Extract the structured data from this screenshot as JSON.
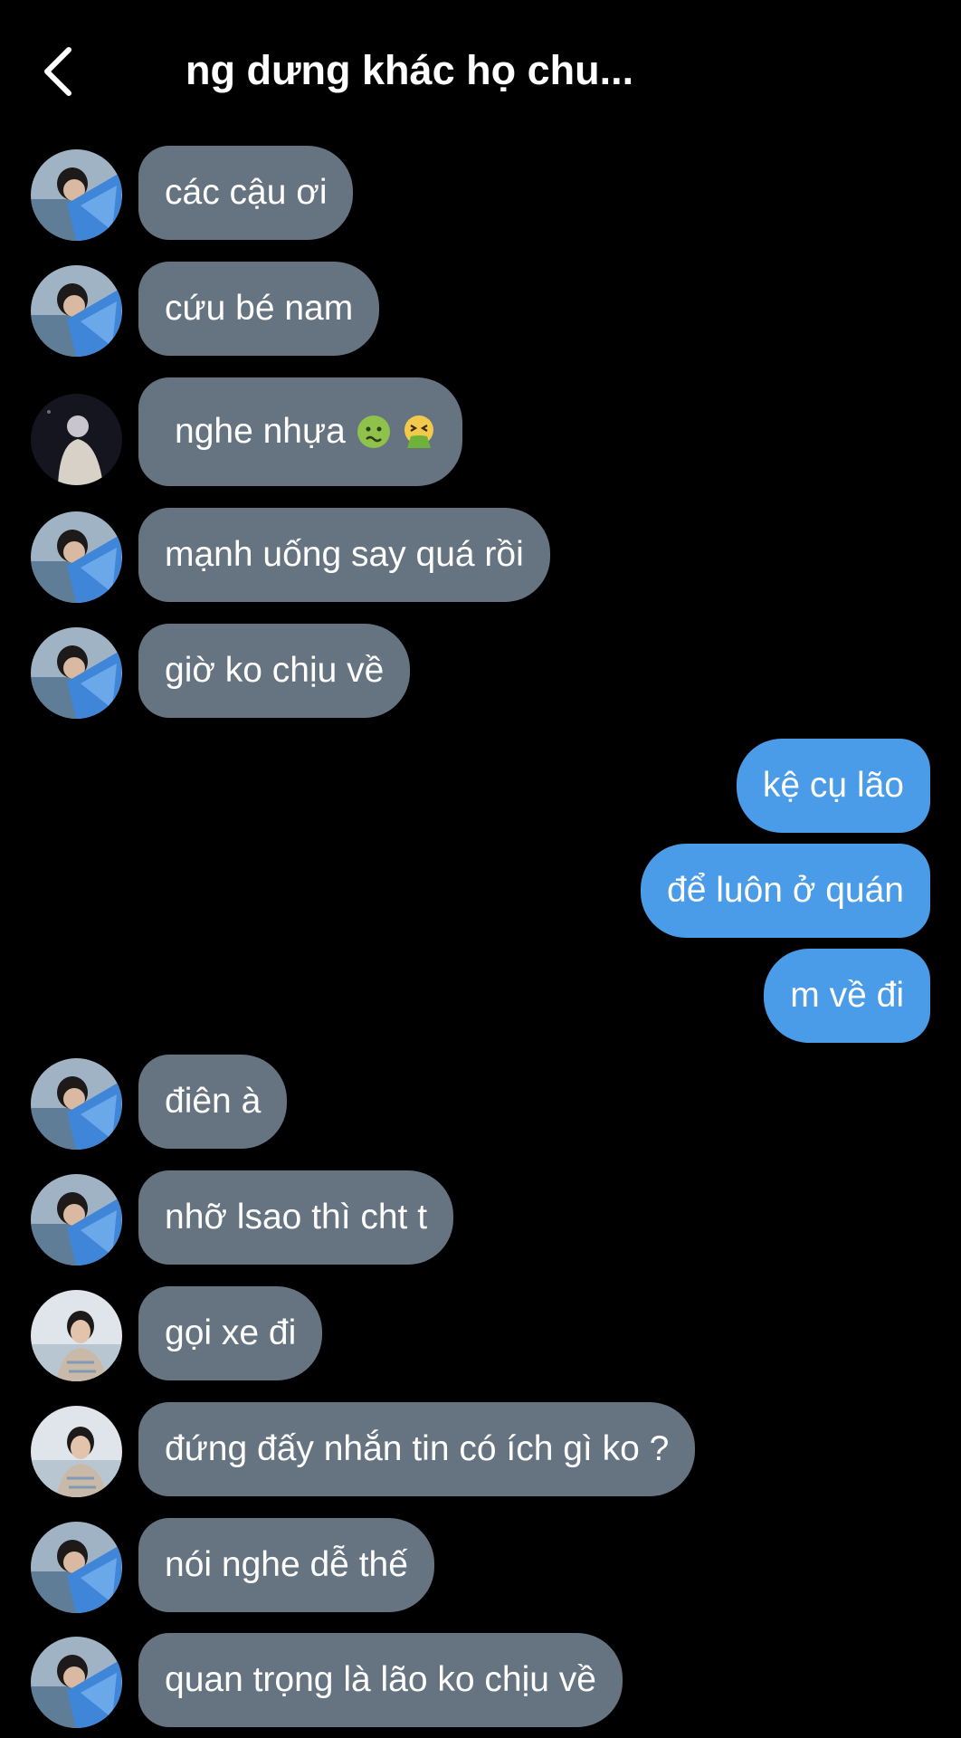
{
  "header": {
    "title": "ng dưng khác họ chu...",
    "back_icon": "chevron-left-icon"
  },
  "colors": {
    "background": "#000000",
    "incoming_bubble": "#667380",
    "outgoing_bubble": "#4a9be8",
    "text": "#ffffff"
  },
  "messages": [
    {
      "direction": "in",
      "sender_avatar": "avatar-boy-blue-shirt",
      "text": "các cậu ơi"
    },
    {
      "direction": "in",
      "sender_avatar": "avatar-boy-blue-shirt",
      "text": "cứu bé nam"
    },
    {
      "direction": "in",
      "sender_avatar": "avatar-figure-dark",
      "text": "nghe nhựa",
      "emojis": [
        "nauseated-face-icon",
        "vomiting-face-icon"
      ]
    },
    {
      "direction": "in",
      "sender_avatar": "avatar-boy-blue-shirt",
      "text": "mạnh uống say quá rồi"
    },
    {
      "direction": "in",
      "sender_avatar": "avatar-boy-blue-shirt",
      "text": "giờ ko chịu về"
    },
    {
      "direction": "out",
      "text": "kệ cụ lão"
    },
    {
      "direction": "out",
      "text": "để luôn ở quán"
    },
    {
      "direction": "out",
      "text": "m về đi"
    },
    {
      "direction": "in",
      "sender_avatar": "avatar-boy-blue-shirt",
      "text": "điên à"
    },
    {
      "direction": "in",
      "sender_avatar": "avatar-boy-blue-shirt",
      "text": "nhỡ lsao thì cht t"
    },
    {
      "direction": "in",
      "sender_avatar": "avatar-boy-light-bg",
      "text": "gọi xe đi"
    },
    {
      "direction": "in",
      "sender_avatar": "avatar-boy-light-bg",
      "text": "đứng đấy nhắn tin có ích gì ko ?"
    },
    {
      "direction": "in",
      "sender_avatar": "avatar-boy-blue-shirt",
      "text": "nói nghe dễ thế"
    },
    {
      "direction": "in",
      "sender_avatar": "avatar-boy-blue-shirt",
      "text": "quan trọng là lão ko chịu về"
    }
  ]
}
